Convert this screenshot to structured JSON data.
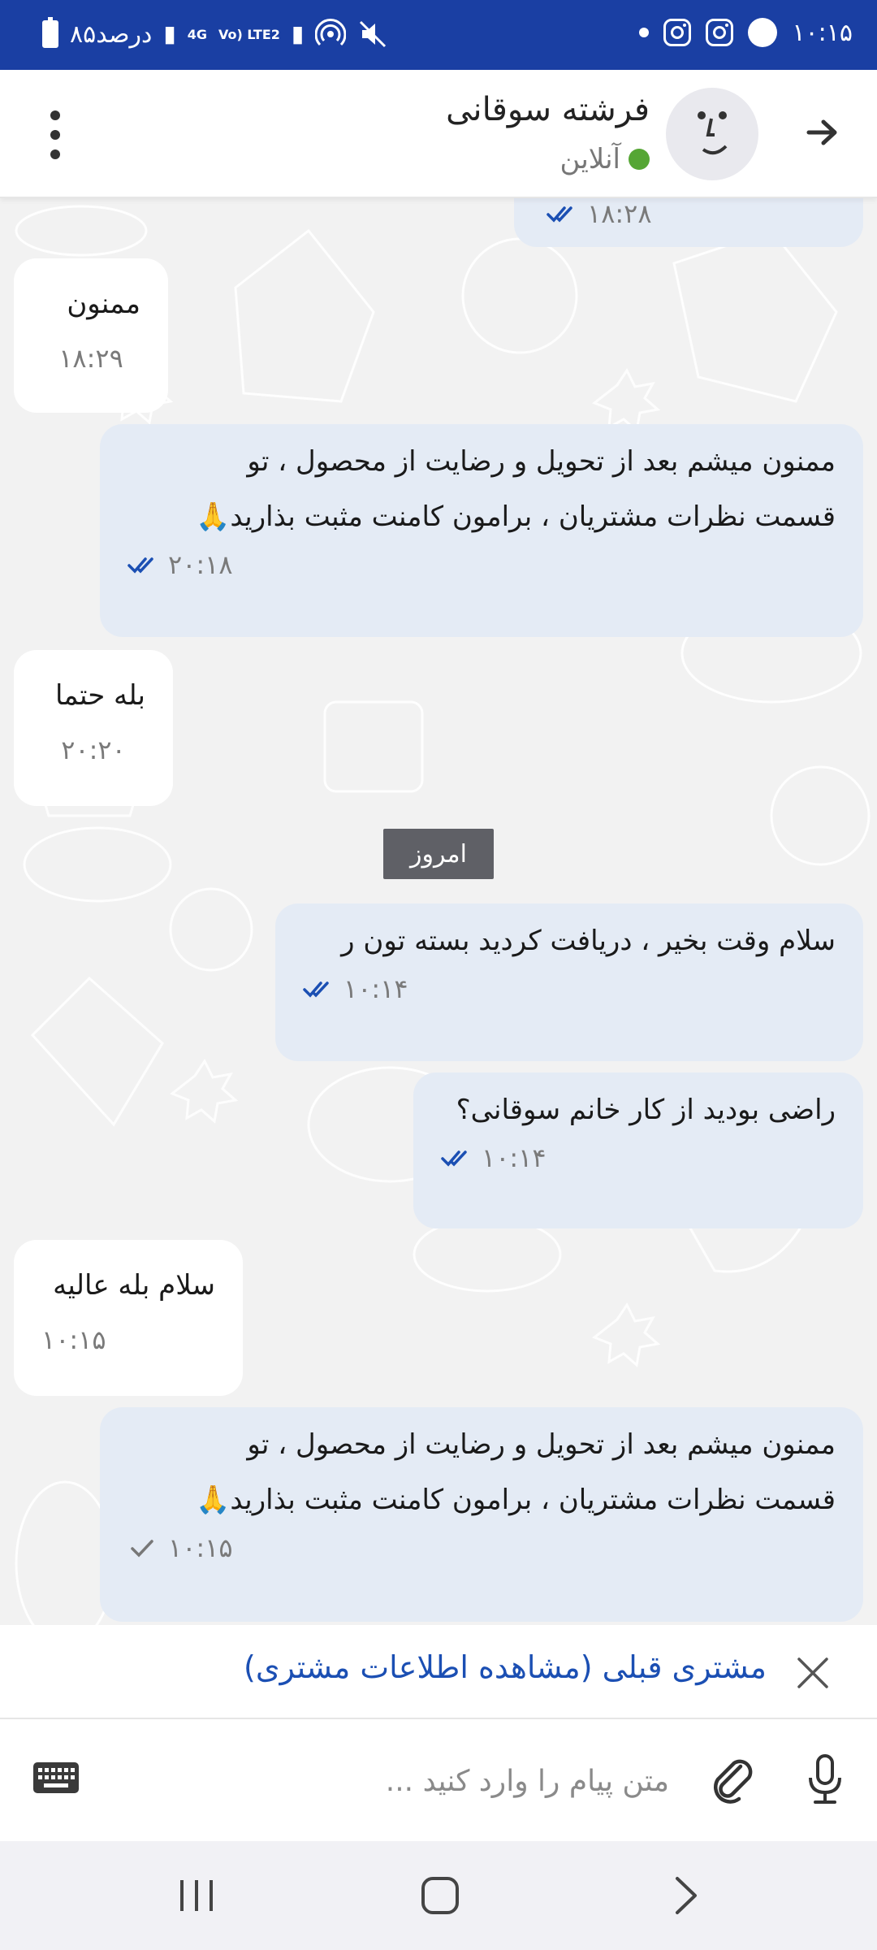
{
  "status_bar": {
    "time": "۱۰:۱۵",
    "battery_text": "۸۵درصد",
    "network_4g": "4G",
    "network_volte": "Vo) LTE2",
    "icons": [
      "face-icon",
      "instagram-icon",
      "instagram-icon",
      "notification-dot",
      "mute-icon",
      "hotspot-icon",
      "signal-icon",
      "signal-icon",
      "battery-icon"
    ]
  },
  "header": {
    "contact_name": "فرشته سوقانی",
    "status": "آنلاین",
    "status_color": "#55a634",
    "icons": [
      "back-arrow-icon",
      "avatar",
      "more-vert-icon"
    ]
  },
  "messages": [
    {
      "direction": "out",
      "text_lines": [],
      "time": "۱۸:۲۸",
      "ticks": "double"
    },
    {
      "direction": "in",
      "text_lines": [
        "ممنون"
      ],
      "time": "۱۸:۲۹"
    },
    {
      "direction": "out",
      "text_lines": [
        "ممنون میشم بعد از تحویل و رضایت از محصول ، تو",
        "قسمت نظرات مشتریان ، برامون کامنت مثبت بذارید🙏"
      ],
      "time": "۲۰:۱۸",
      "ticks": "double"
    },
    {
      "direction": "in",
      "text_lines": [
        "بله حتما"
      ],
      "time": "۲۰:۲۰"
    },
    {
      "direction": "out",
      "text_lines": [
        "سلام وقت بخیر ، دریافت کردید بسته تون ر"
      ],
      "time": "۱۰:۱۴",
      "ticks": "double"
    },
    {
      "direction": "out",
      "text_lines": [
        "راضی بودید از کار خانم سوقانی؟"
      ],
      "time": "۱۰:۱۴",
      "ticks": "double"
    },
    {
      "direction": "in",
      "text_lines": [
        "سلام بله عالیه"
      ],
      "time": "۱۰:۱۵"
    },
    {
      "direction": "out",
      "text_lines": [
        "ممنون میشم بعد از تحویل و رضایت از محصول ، تو",
        "قسمت نظرات مشتریان ، برامون کامنت مثبت بذارید🙏"
      ],
      "time": "۱۰:۱۵",
      "ticks": "single"
    }
  ],
  "date_divider": "امروز",
  "customer_info": {
    "link_text": "مشتری قبلی (مشاهده اطلاعات مشتری)",
    "link_color": "#1b4fb3"
  },
  "composer": {
    "placeholder": "متن پیام را وارد کنید ...",
    "icons": [
      "mic-icon",
      "attach-icon",
      "keyboard-icon"
    ]
  },
  "nav_bar": {
    "icons": [
      "recents-icon",
      "home-icon",
      "back-icon"
    ]
  },
  "colors": {
    "status_bar": "#1a3fa3",
    "outgoing_bubble": "#e4ebf5",
    "incoming_bubble": "#ffffff",
    "tick_color": "#1b4fb3"
  }
}
